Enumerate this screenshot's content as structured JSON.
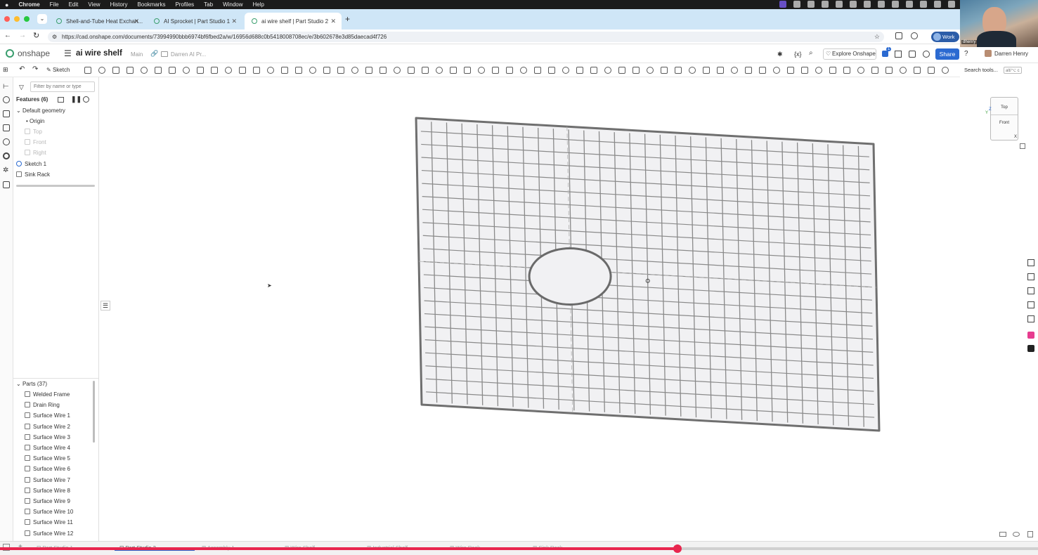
{
  "menubar": {
    "app": "Chrome",
    "items": [
      "File",
      "Edit",
      "View",
      "History",
      "Bookmarks",
      "Profiles",
      "Tab",
      "Window",
      "Help"
    ]
  },
  "browser": {
    "tabs": [
      {
        "label": "Shell-and-Tube Heat Exchan..."
      },
      {
        "label": "AI Sprocket | Part Studio 1"
      },
      {
        "label": "ai wire shelf | Part Studio 2",
        "active": true
      }
    ],
    "new_tab": "+",
    "url": "https://cad.onshape.com/documents/73994990bbb6974bf6fbed2a/w/16956d688c0b5418008708ec/e/3b602678e3d85daecad4f726",
    "profile": "Work"
  },
  "onshape": {
    "logo": "onshape",
    "doc_title": "ai wire shelf",
    "branch": "Main",
    "folder": "Darren AI Pr...",
    "explore": "Explore Onshape",
    "notification_count": "1",
    "share": "Share",
    "user": "Darren Henry",
    "sketch_label": "Sketch",
    "search_tools": "Search tools...",
    "search_shortcut": "alt/⌥ c"
  },
  "features": {
    "filter_placeholder": "Filter by name or type",
    "header": "Features (6)",
    "default_geometry": "Default geometry",
    "items": [
      {
        "label": "Origin",
        "dim": false
      },
      {
        "label": "Top",
        "dim": true
      },
      {
        "label": "Front",
        "dim": true
      },
      {
        "label": "Right",
        "dim": true
      }
    ],
    "sketch": "Sketch 1",
    "sink_rack": "Sink Rack"
  },
  "parts": {
    "header": "Parts (37)",
    "items": [
      "Welded Frame",
      "Drain Ring",
      "Surface Wire 1",
      "Surface Wire 2",
      "Surface Wire 3",
      "Surface Wire 4",
      "Surface Wire 5",
      "Surface Wire 6",
      "Surface Wire 7",
      "Surface Wire 8",
      "Surface Wire 9",
      "Surface Wire 10",
      "Surface Wire 11",
      "Surface Wire 12"
    ]
  },
  "viewcube": {
    "top": "Top",
    "front": "Front",
    "axis_x": "X",
    "axis_z": "Z",
    "axis_y": "Y"
  },
  "bottom_tabs": [
    "Part Studio 1",
    "Part Studio 2",
    "Assembly 1",
    "Wire Shelf",
    "Industrial Shelf",
    "Wire Rack",
    "Sink Rack"
  ],
  "video": {
    "progress": 0.653
  },
  "webcam": {
    "label": "dhenry"
  },
  "colors": {
    "accent": "#2b6ad1",
    "progress": "#e8264e",
    "tabbar": "#cfe6f7",
    "wire": "#8a8a8a"
  }
}
